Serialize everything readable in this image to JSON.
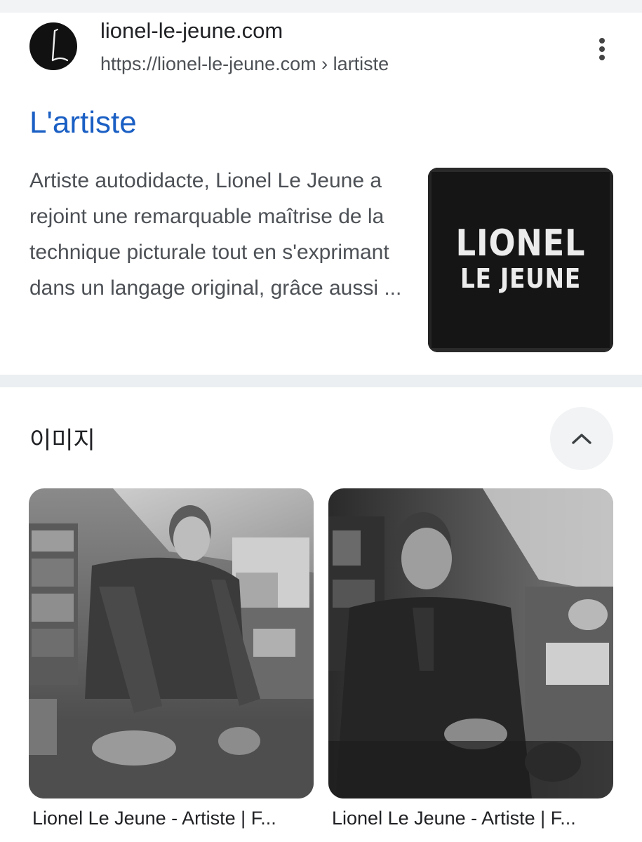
{
  "result": {
    "site_name": "lionel-le-jeune.com",
    "url": "https://lionel-le-jeune.com › lartiste",
    "title": "L'artiste",
    "snippet": "Artiste autodidacte, Lionel Le Jeune a rejoint une remarquable maîtrise de la technique picturale tout en s'exprimant dans un langage original, grâce aussi ...",
    "favicon_icon": "artist-logo-icon",
    "more_icon": "more-vert-icon",
    "thumbnail": {
      "line1": "LIONEL",
      "line2": "LE JEUNE"
    }
  },
  "images": {
    "heading": "이미지",
    "collapse_icon": "chevron-up-icon",
    "items": [
      {
        "caption": "Lionel Le Jeune - Artiste | F..."
      },
      {
        "caption": "Lionel Le Jeune - Artiste | F..."
      }
    ]
  },
  "colors": {
    "link": "#1a5fc4",
    "url_gray": "#4d5156",
    "divider": "#eceff1"
  }
}
